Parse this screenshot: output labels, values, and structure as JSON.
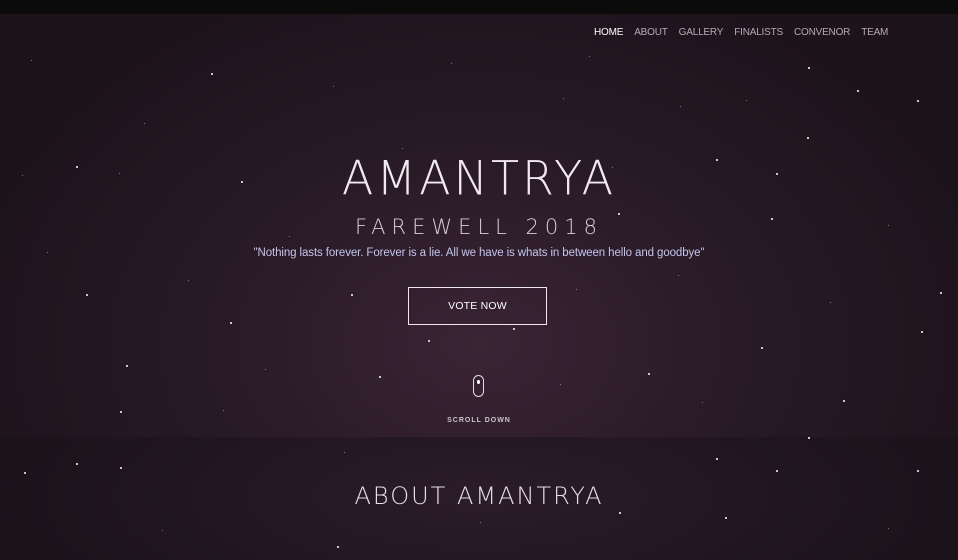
{
  "nav": {
    "items": [
      {
        "label": "HOME",
        "active": true
      },
      {
        "label": "ABOUT",
        "active": false
      },
      {
        "label": "GALLERY",
        "active": false
      },
      {
        "label": "FINALISTS",
        "active": false
      },
      {
        "label": "CONVENOR",
        "active": false
      },
      {
        "label": "TEAM",
        "active": false
      }
    ]
  },
  "hero": {
    "title": "AMANTRYA",
    "subtitle": "FAREWELL 2018",
    "quote": "\"Nothing lasts forever. Forever is a lie. All we have is whats in between hello and goodbye\"",
    "vote_label": "VOTE NOW",
    "scroll_label": "SCROLL DOWN"
  },
  "about": {
    "title": "ABOUT AMANTRYA"
  },
  "colors": {
    "background": "#1f141d",
    "hero_glow": "#3a2435",
    "quote_text": "#c3c6ef",
    "nav_active": "#ffffff",
    "nav_inactive": "#b9a8b6"
  },
  "icons": {
    "scroll": "mouse-scroll-icon"
  }
}
